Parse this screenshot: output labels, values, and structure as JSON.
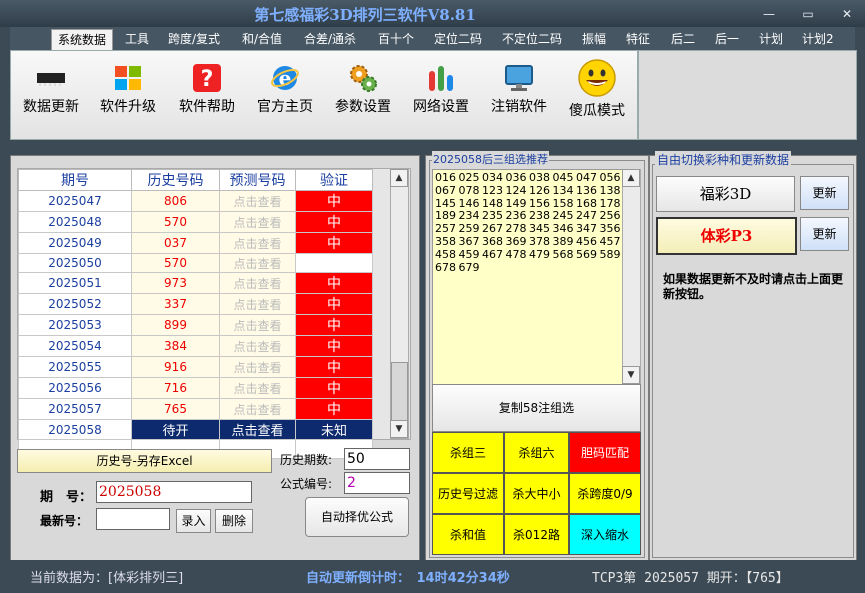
{
  "window": {
    "title": "第七感福彩3D排列三软件V8.81",
    "min_label": "—",
    "max_label": "▭",
    "close_label": "✕"
  },
  "menu": [
    {
      "label": "系统数据",
      "active": true
    },
    {
      "label": "工具"
    },
    {
      "label": "跨度/复式"
    },
    {
      "label": "和/合值"
    },
    {
      "label": "合差/通杀"
    },
    {
      "label": "百十个"
    },
    {
      "label": "定位二码"
    },
    {
      "label": "不定位二码"
    },
    {
      "label": "振幅"
    },
    {
      "label": "特征"
    },
    {
      "label": "后二"
    },
    {
      "label": "后一"
    },
    {
      "label": "计划"
    },
    {
      "label": "计划2"
    }
  ],
  "toolbar": [
    {
      "label": "数据更新",
      "icon": "data-chip-icon"
    },
    {
      "label": "软件升级",
      "icon": "windows-logo-icon"
    },
    {
      "label": "软件帮助",
      "icon": "help-icon"
    },
    {
      "label": "官方主页",
      "icon": "internet-explorer-icon"
    },
    {
      "label": "参数设置",
      "icon": "gears-icon"
    },
    {
      "label": "网络设置",
      "icon": "bar-chart-icon"
    },
    {
      "label": "注销软件",
      "icon": "monitor-icon"
    },
    {
      "label": "傻瓜模式",
      "icon": "smiley-icon"
    }
  ],
  "history": {
    "headers": [
      "期号",
      "历史号码",
      "预测号码",
      "验证"
    ],
    "rows": [
      {
        "issue": "2025047",
        "history": "806",
        "predict": "点击查看",
        "verify": "中"
      },
      {
        "issue": "2025048",
        "history": "570",
        "predict": "点击查看",
        "verify": "中"
      },
      {
        "issue": "2025049",
        "history": "037",
        "predict": "点击查看",
        "verify": "中"
      },
      {
        "issue": "2025050",
        "history": "570",
        "predict": "点击查看",
        "verify": ""
      },
      {
        "issue": "2025051",
        "history": "973",
        "predict": "点击查看",
        "verify": "中"
      },
      {
        "issue": "2025052",
        "history": "337",
        "predict": "点击查看",
        "verify": "中"
      },
      {
        "issue": "2025053",
        "history": "899",
        "predict": "点击查看",
        "verify": "中"
      },
      {
        "issue": "2025054",
        "history": "384",
        "predict": "点击查看",
        "verify": "中"
      },
      {
        "issue": "2025055",
        "history": "916",
        "predict": "点击查看",
        "verify": "中"
      },
      {
        "issue": "2025056",
        "history": "716",
        "predict": "点击查看",
        "verify": "中"
      },
      {
        "issue": "2025057",
        "history": "765",
        "predict": "点击查看",
        "verify": "中"
      }
    ],
    "current": {
      "issue": "2025058",
      "history": "待开",
      "predict": "点击查看",
      "verify": "未知"
    }
  },
  "left_form": {
    "export_label": "历史号-另存Excel",
    "issue_label": "期　号：",
    "issue_value": "2025058",
    "latest_label": "最新号：",
    "latest_value": "",
    "enter_label": "录入",
    "delete_label": "删除",
    "period_count_label": "历史期数:",
    "period_count_value": "50",
    "formula_label": "公式编号:",
    "formula_value": "2",
    "auto_formula_label": "自动择优公式"
  },
  "recommend": {
    "title": "2025058后三组选推荐",
    "numbers": "016 025 034 036 038 045 047 056 067 078 123 124 126 134 136 138 145 146 148 149 156 158 168 178 189 234 235 236 238 245 247 256 257 259 267 278 345 346 347 356 358 367 368 369 378 389 456 457 458 459 467 478 479 568 569 589 678 679",
    "copy_label": "复制58注组选",
    "buttons": [
      {
        "label": "杀组三",
        "color": "#ffff00",
        "text_color": "#000"
      },
      {
        "label": "杀组六",
        "color": "#ffff00",
        "text_color": "#000"
      },
      {
        "label": "胆码匹配",
        "color": "#ff0000",
        "text_color": "#fff"
      },
      {
        "label": "历史号过滤",
        "color": "#ffff00",
        "text_color": "#000"
      },
      {
        "label": "杀大中小",
        "color": "#ffff00",
        "text_color": "#000"
      },
      {
        "label": "杀跨度0/9",
        "color": "#ffff00",
        "text_color": "#000"
      },
      {
        "label": "杀和值",
        "color": "#ffff00",
        "text_color": "#000"
      },
      {
        "label": "杀012路",
        "color": "#ffff00",
        "text_color": "#000"
      },
      {
        "label": "深入缩水",
        "color": "#00ffff",
        "text_color": "#000"
      }
    ]
  },
  "switch": {
    "title": "自由切换彩种和更新数据",
    "fc3d_label": "福彩3D",
    "p3_label": "体彩P3",
    "update_label": "更新",
    "note": "如果数据更新不及时请点击上面更新按钮。"
  },
  "status": {
    "current_data": "当前数据为：[体彩排列三]",
    "countdown": "自动更新倒计时：　14时42分34秒",
    "last_draw": "TCP3第 2025057 期开：【765】"
  }
}
